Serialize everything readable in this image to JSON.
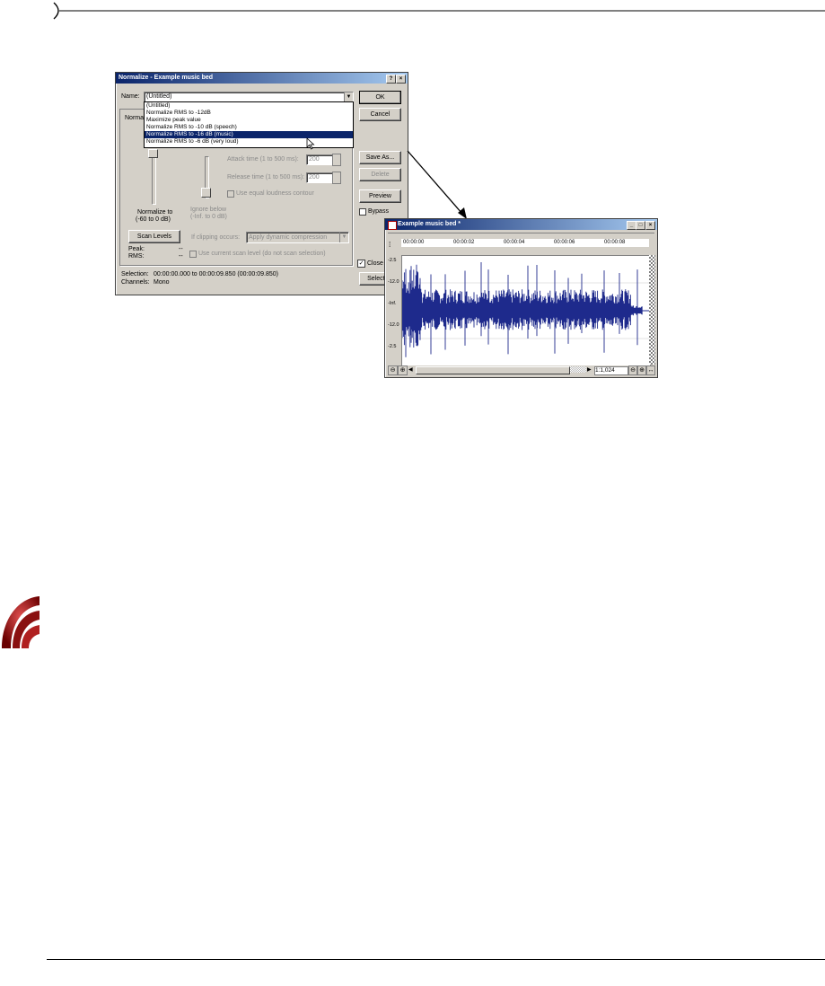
{
  "dialog": {
    "title": "Normalize - Example music bed",
    "help_btn": "?",
    "close_btn": "×",
    "name_label": "Name:",
    "name_value": "(Untitled)",
    "preset_options": [
      "(Untitled)",
      "Normalize RMS to -12dB",
      "Maximize peak value",
      "Normalize RMS to -10 dB (speech)",
      "Normalize RMS to -16 dB (music)",
      "Normalize RMS to -6 dB (very loud)"
    ],
    "selected_option_index": 4,
    "ok": "OK",
    "cancel": "Cancel",
    "save_as": "Save As...",
    "delete": "Delete",
    "preview": "Preview",
    "bypass": "Bypass",
    "group_label": "Norma",
    "normalize_to_label": "Normalize to",
    "normalize_range": "(-60 to 0 dB)",
    "ignore_below_label": "Ignore below",
    "ignore_range": "(-Inf. to 0 dB)",
    "attack_label": "Attack time (1 to 500 ms):",
    "attack_value": "200",
    "release_label": "Release time (1 to 500 ms):",
    "release_value": "200",
    "equal_loudness": "Use equal loudness contour",
    "scan_levels": "Scan Levels",
    "clipping_label": "If clipping occurs:",
    "clipping_value": "Apply dynamic compression",
    "peak_label": "Peak:",
    "rms_label": "RMS:",
    "peak_value": "--",
    "rms_value": "--",
    "use_current": "Use current scan level (do not scan selection)",
    "selection_label": "Selection:",
    "selection_value": "00:00:00.000 to 00:00:09.850 (00:00:09.850)",
    "channels_label": "Channels:",
    "channels_value": "Mono",
    "close_cb": "Close",
    "selection_btn": "Selection"
  },
  "wave": {
    "title": "Example music bed *",
    "ruler": [
      "00:00:00",
      "00:00:02",
      "00:00:04",
      "00:00:06",
      "00:00:08"
    ],
    "db_labels": [
      "-2.5",
      "-12.0",
      "-Inf.",
      "-12.0",
      "-2.5"
    ],
    "zoom": "1:1,024"
  }
}
